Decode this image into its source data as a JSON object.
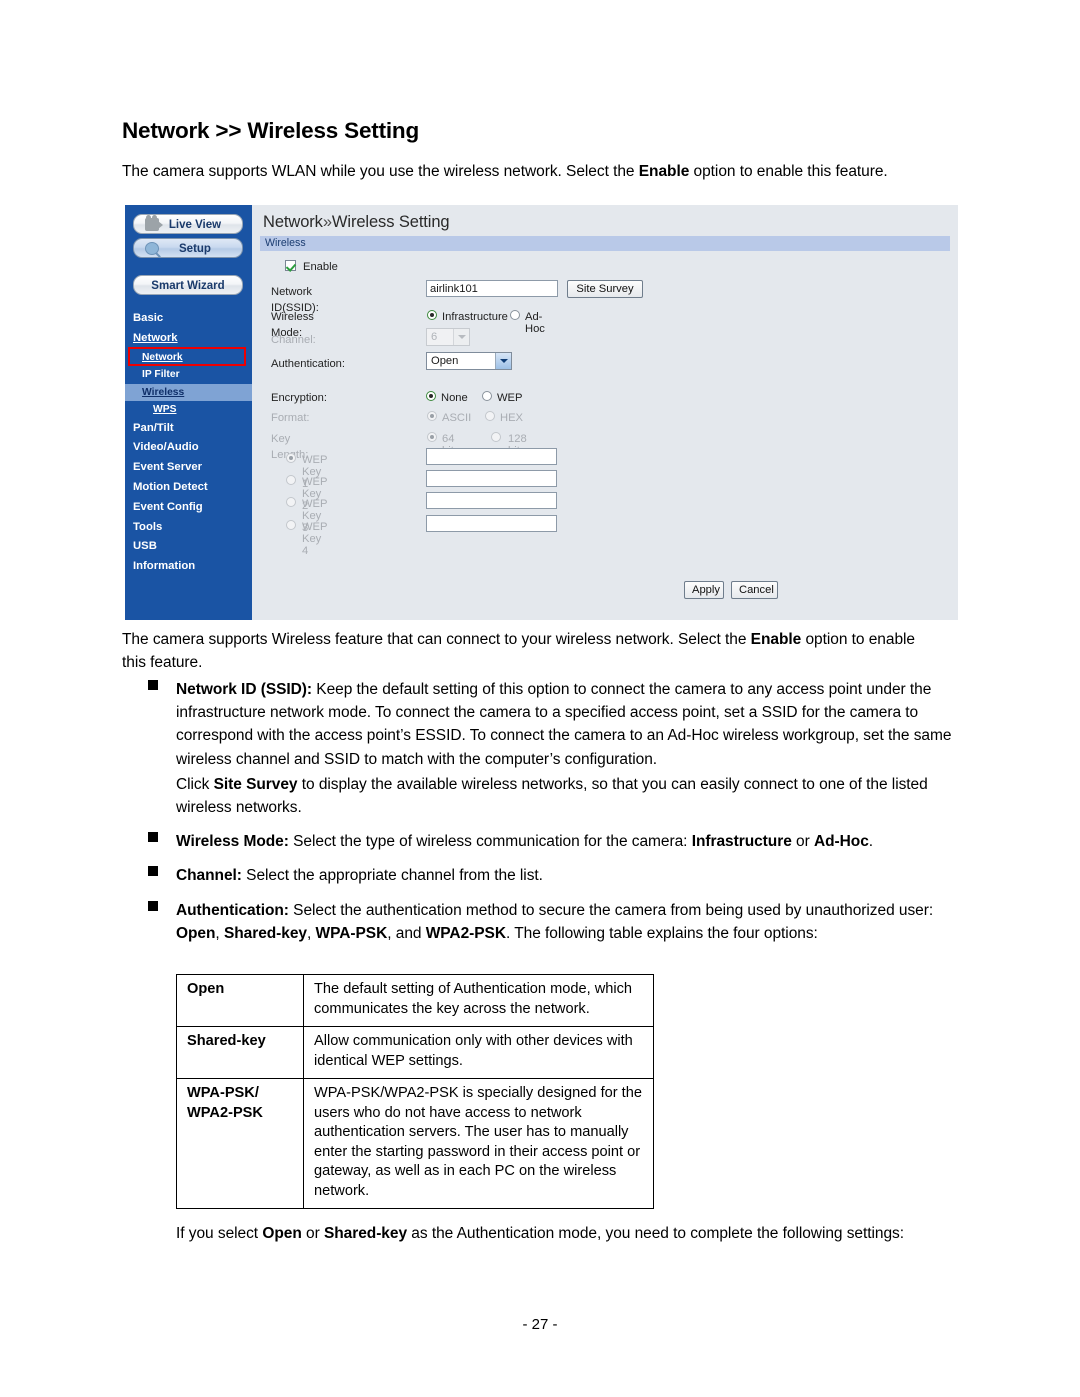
{
  "document": {
    "title": "Network >> Wireless Setting",
    "intro": {
      "before": "The camera supports WLAN while you use the wireless network. Select the ",
      "bold": "Enable",
      "after": " option to enable this feature."
    },
    "below_shot": {
      "before": "The camera supports Wireless feature that can connect to your wireless network. Select the ",
      "bold": "Enable",
      "after": " option to enable this feature."
    },
    "bullets": [
      {
        "term": "Network ID (SSID):",
        "body": " Keep the default setting of this option to connect the camera to any access point under the infrastructure network mode. To connect the camera to a specified access point, set a SSID for the camera to correspond with the access point’s ESSID. To connect the camera to an Ad-Hoc wireless workgroup, set the same wireless channel and SSID to match with the computer’s configuration.",
        "sub_before": "Click ",
        "sub_bold": "Site Survey",
        "sub_after": " to display the available wireless networks, so that you can easily connect to one of the listed wireless networks."
      },
      {
        "term": "Wireless Mode:",
        "body_1": " Select the type of wireless communication for the camera: ",
        "bold_1": "Infrastructure",
        "body_2": " or ",
        "bold_2": "Ad-Hoc",
        "body_3": "."
      },
      {
        "term": "Channel:",
        "body": " Select the appropriate channel from the list."
      },
      {
        "term": "Authentication:",
        "body_1": " Select the authentication method to secure the camera from being used by unauthorized user: ",
        "bold_1": "Open",
        "body_2": ", ",
        "bold_2": "Shared-key",
        "body_3": ", ",
        "bold_3": "WPA-PSK",
        "body_4": ", and ",
        "bold_4": "WPA2-PSK",
        "body_5": ". The following table explains the four options:"
      }
    ],
    "auth_table": {
      "rows": [
        {
          "key": "Open",
          "value": "The default setting of Authentication mode, which communicates the key across the network."
        },
        {
          "key": "Shared-key",
          "value": "Allow communication only with other devices with identical WEP settings."
        },
        {
          "key": "WPA-PSK/",
          "key_line2": "WPA2-PSK",
          "value": "WPA-PSK/WPA2-PSK is specially designed for the users who do not have access to network authentication servers. The user has to manually enter the starting password in their access point or gateway, as well as in each PC on the wireless network."
        }
      ]
    },
    "closing": {
      "before": "If you select ",
      "bold_1": "Open",
      "mid": " or ",
      "bold_2": "Shared-key",
      "after": " as the Authentication mode, you need to complete the following settings:"
    },
    "page_number": "- 27 -"
  },
  "screenshot": {
    "sidebar": {
      "buttons": [
        {
          "label": "Live View",
          "icon": "camcorder-icon",
          "state": "normal"
        },
        {
          "label": "Setup",
          "icon": "magnifier-icon",
          "state": "active"
        },
        {
          "label": "Smart Wizard",
          "icon": "none",
          "state": "normal"
        }
      ],
      "nav": [
        {
          "label": "Basic",
          "level": 1,
          "underline": false,
          "selected": false
        },
        {
          "label": "Network",
          "level": 1,
          "underline": true,
          "selected": false
        },
        {
          "label": "Network",
          "level": 2,
          "underline": true,
          "selected": false
        },
        {
          "label": "IP Filter",
          "level": 2,
          "underline": false,
          "selected": false
        },
        {
          "label": "Wireless",
          "level": 2,
          "underline": true,
          "selected": true
        },
        {
          "label": "WPS",
          "level": 3,
          "underline": true,
          "selected": false
        },
        {
          "label": "Pan/Tilt",
          "level": 1,
          "underline": false,
          "selected": false
        },
        {
          "label": "Video/Audio",
          "level": 1,
          "underline": false,
          "selected": false
        },
        {
          "label": "Event Server",
          "level": 1,
          "underline": false,
          "selected": false
        },
        {
          "label": "Motion Detect",
          "level": 1,
          "underline": false,
          "selected": false
        },
        {
          "label": "Event Config",
          "level": 1,
          "underline": false,
          "selected": false
        },
        {
          "label": "Tools",
          "level": 1,
          "underline": false,
          "selected": false
        },
        {
          "label": "USB",
          "level": 1,
          "underline": false,
          "selected": false
        },
        {
          "label": "Information",
          "level": 1,
          "underline": false,
          "selected": false
        }
      ]
    },
    "main": {
      "title_part1": "Network",
      "title_chevron": "»",
      "title_part2": "Wireless Setting",
      "section_bar": "Wireless",
      "enable_label": "Enable",
      "enable_checked": true,
      "fields": {
        "ssid_label": "Network ID(SSID):",
        "ssid_value": "airlink101",
        "site_survey_button": "Site Survey",
        "wireless_mode_label": "Wireless Mode:",
        "mode_option_1": "Infrastructure",
        "mode_option_2": "Ad-Hoc",
        "channel_label": "Channel:",
        "channel_value": "6",
        "authentication_label": "Authentication:",
        "authentication_value": "Open",
        "encryption_label": "Encryption:",
        "encryption_option_1": "None",
        "encryption_option_2": "WEP",
        "format_label": "Format:",
        "format_option_1": "ASCII",
        "format_option_2": "HEX",
        "keylen_label": "Key Length:",
        "keylen_option_1": "64 bits",
        "keylen_option_2": "128 bits"
      },
      "wep_keys": [
        {
          "label": "WEP Key 1",
          "value": "",
          "selected": true
        },
        {
          "label": "WEP Key 2",
          "value": "",
          "selected": false
        },
        {
          "label": "WEP Key 3",
          "value": "",
          "selected": false
        },
        {
          "label": "WEP Key 4",
          "value": "",
          "selected": false
        }
      ],
      "apply_button": "Apply",
      "cancel_button": "Cancel"
    },
    "colors": {
      "sidebar_blue": "#1a54a4",
      "panel_bg": "#e4e8ed",
      "section_bar": "#b9c9e8",
      "selected_nav": "#7fa3d4",
      "annotation_red": "#ee0000"
    }
  }
}
